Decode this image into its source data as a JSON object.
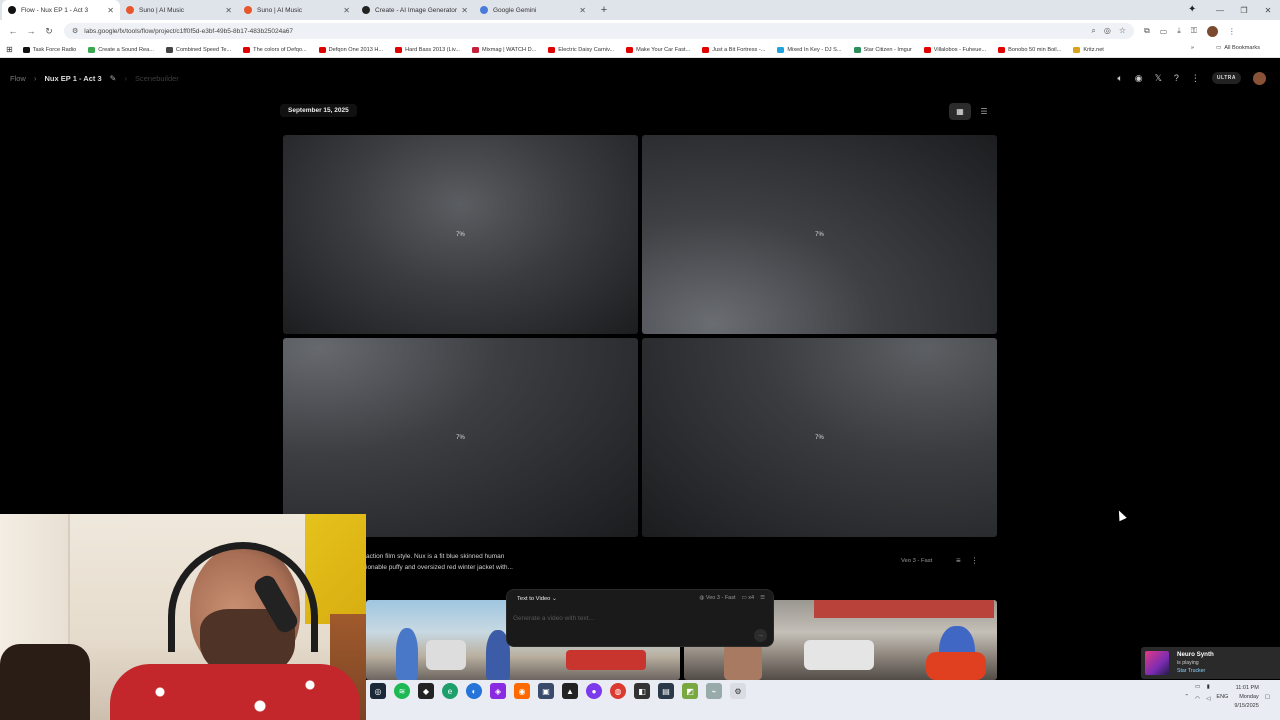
{
  "browser": {
    "tabs": [
      {
        "title": "Flow - Nux EP 1 - Act 3",
        "favicon_color": "#111111",
        "active": true
      },
      {
        "title": "Suno | AI Music",
        "favicon_color": "#e8572c",
        "active": false
      },
      {
        "title": "Suno | AI Music",
        "favicon_color": "#e8572c",
        "active": false
      },
      {
        "title": "Create - AI Image Generator | L",
        "favicon_color": "#222222",
        "active": false
      },
      {
        "title": "Google Gemini",
        "favicon_color": "#4b7bd9",
        "active": false
      }
    ],
    "url": "labs.google/fx/tools/flow/project/c1ff0f5d-e3bf-49b5-8b17-483b25024a67",
    "bookmarks": [
      {
        "label": "Task Force Radio",
        "color": "#111111"
      },
      {
        "label": "Create a Sound Rea...",
        "color": "#3aa84f"
      },
      {
        "label": "Combined Speed Te...",
        "color": "#444444"
      },
      {
        "label": "The colors of Defqo...",
        "color": "#e00000"
      },
      {
        "label": "Defqon One 2013 H...",
        "color": "#e00000"
      },
      {
        "label": "Hard Bass 2013 (Liv...",
        "color": "#e00000"
      },
      {
        "label": "Mixmag | WATCH D...",
        "color": "#c41f3b"
      },
      {
        "label": "Electric Daisy Carniv...",
        "color": "#e00000"
      },
      {
        "label": "Make Your Car Fast...",
        "color": "#e00000"
      },
      {
        "label": "Just a Bit Fortress -...",
        "color": "#e00000"
      },
      {
        "label": "Mixed In Key - DJ S...",
        "color": "#1fa3e0"
      },
      {
        "label": "Star Citizen - Imgur",
        "color": "#2b8f5c"
      },
      {
        "label": "Villalobos - Fuheue...",
        "color": "#e00000"
      },
      {
        "label": "Bonobo 50 min Boil...",
        "color": "#e00000"
      },
      {
        "label": "Kritz.net",
        "color": "#d6a31a"
      }
    ],
    "all_bookmarks": "All Bookmarks"
  },
  "app": {
    "breadcrumb": {
      "root": "Flow",
      "project": "Nux EP 1 - Act 3",
      "mode": "Scenebuilder"
    },
    "badge": "ULTRA",
    "date_label": "September 15, 2025",
    "tiles": [
      {
        "progress": "7%"
      },
      {
        "progress": "7%"
      },
      {
        "progress": "7%"
      },
      {
        "progress": "7%"
      }
    ],
    "prompt_line1": "action film style. Nux is a fit blue skinned human",
    "prompt_line2": "ionable puffy and oversized red winter jacket with...",
    "model": "Veo 3 - Fast",
    "composer": {
      "mode": "Text to Video",
      "model": "Veo 3 - Fast",
      "count": "x4",
      "placeholder": "Generate a video with text..."
    }
  },
  "taskbar": {
    "lang": "ENG",
    "time": "11:01 PM",
    "day": "Monday",
    "date": "9/15/2025"
  },
  "now_playing": {
    "artist": "Neuro Synth",
    "status": "is playing",
    "track": "Star Trucker"
  }
}
